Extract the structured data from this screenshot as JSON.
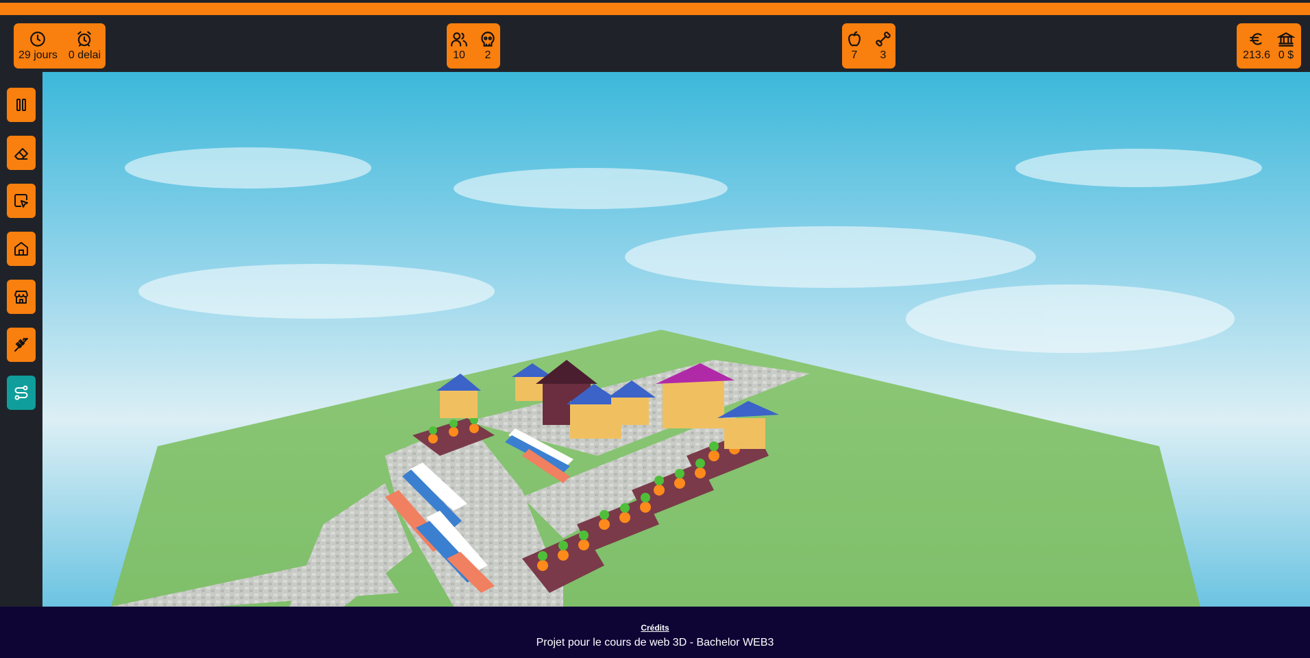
{
  "hud": {
    "time": {
      "days": "29 jours",
      "delay": "0 delai",
      "days_icon": "clock-icon",
      "delay_icon": "alarm-icon"
    },
    "population": {
      "people": "10",
      "deaths": "2",
      "people_icon": "users-icon",
      "deaths_icon": "skull-icon"
    },
    "resources": {
      "food": "7",
      "bones": "3",
      "food_icon": "apple-icon",
      "bones_icon": "bone-icon"
    },
    "money": {
      "balance": "213.6",
      "bank": "0 $",
      "balance_icon": "euro-icon",
      "bank_icon": "bank-icon"
    }
  },
  "sidebar": {
    "tools": [
      {
        "name": "pause",
        "icon": "pause-icon"
      },
      {
        "name": "erase",
        "icon": "eraser-icon"
      },
      {
        "name": "select",
        "icon": "select-pointer-icon"
      },
      {
        "name": "house",
        "icon": "home-icon"
      },
      {
        "name": "market",
        "icon": "store-icon"
      },
      {
        "name": "farm",
        "icon": "wheat-icon"
      },
      {
        "name": "road",
        "icon": "route-icon",
        "active": true
      }
    ]
  },
  "colors": {
    "accent": "#f97f0e",
    "active_tool": "#0f9e9b",
    "background": "#1f2329",
    "footer": "#0e0535"
  },
  "footer": {
    "credits": "Crédits",
    "description": "Projet pour le cours de web 3D - Bachelor WEB3"
  }
}
